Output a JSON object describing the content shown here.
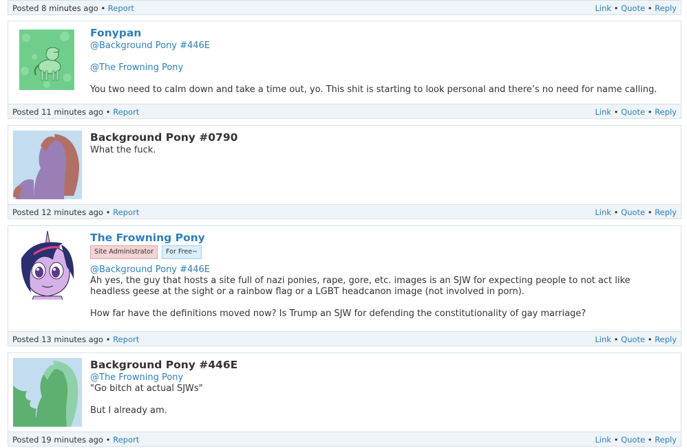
{
  "footers": [
    {
      "posted": "Posted 8 minutes ago",
      "report": "Report"
    },
    {
      "posted": "Posted 11 minutes ago",
      "report": "Report"
    },
    {
      "posted": "Posted 12 minutes ago",
      "report": "Report"
    },
    {
      "posted": "Posted 13 minutes ago",
      "report": "Report"
    },
    {
      "posted": "Posted 19 minutes ago",
      "report": "Report"
    }
  ],
  "actions": {
    "link": "Link",
    "quote": "Quote",
    "reply": "Reply"
  },
  "posts": [
    {
      "author": "Fonypan",
      "lines": [
        "@Background Pony #446E",
        "@The Frowning Pony",
        "You two need to calm down and take a time out, yo. This shit is starting to look personal and there’s no need for name calling."
      ]
    },
    {
      "author": "Background Pony #0790",
      "lines": [
        "What the fuck."
      ]
    },
    {
      "author": "The Frowning Pony",
      "badges": [
        "Site Administrator",
        "For Free~"
      ],
      "lines": [
        "@Background Pony #446E",
        "Ah yes, the guy that hosts a site full of nazi ponies, rape, gore, etc. images is an SJW for expecting people to not act like",
        "headless geese at the sight or a rainbow flag or a LGBT headcanon image (not involved in porn).",
        "How far have the definitions moved now? Is Trump an SJW for defending the constitutionality of gay marriage?"
      ]
    },
    {
      "author": "Background Pony #446E",
      "lines": [
        "@The Frowning Pony",
        "\"Go bitch at actual SJWs\"",
        "But I already am."
      ]
    }
  ]
}
